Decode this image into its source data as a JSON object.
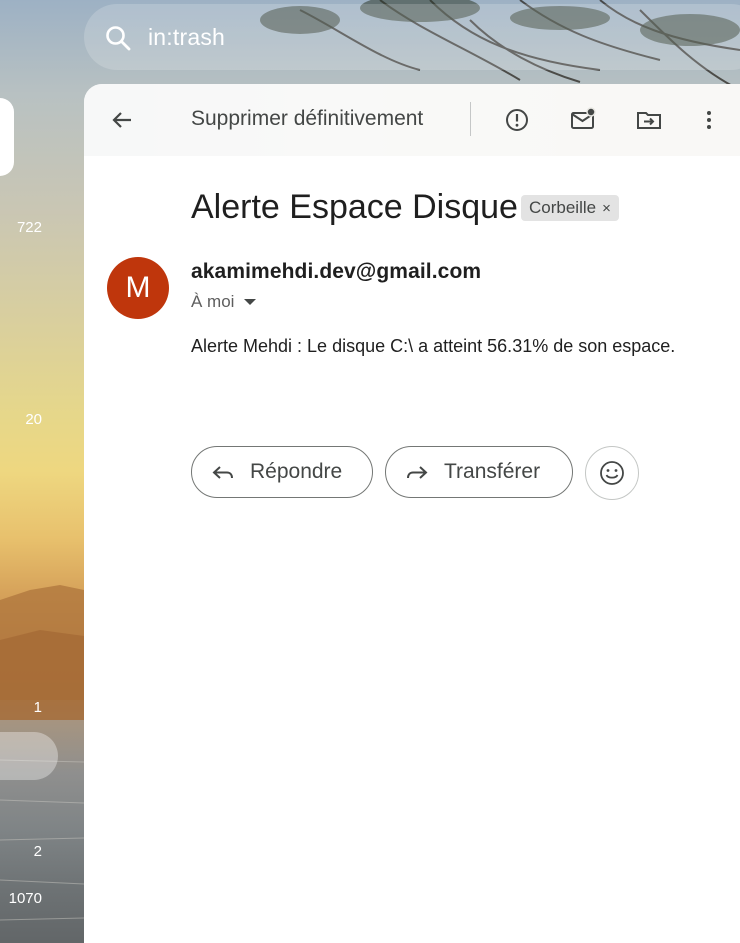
{
  "search": {
    "query": "in:trash",
    "icon": "search-icon"
  },
  "rail": {
    "counts": [
      "722",
      "20",
      "1",
      "2",
      "1070"
    ]
  },
  "toolbar": {
    "back_icon": "arrow-back-icon",
    "delete_forever_label": "Supprimer définitivement",
    "report_spam_icon": "report-spam-icon",
    "mark_unread_icon": "mark-unread-icon",
    "move_to_icon": "move-to-folder-icon",
    "more_icon": "more-vertical-icon"
  },
  "message": {
    "subject": "Alerte Espace Disque",
    "label": "Corbeille",
    "label_remove": "×",
    "avatar_letter": "M",
    "avatar_color": "#bf360c",
    "sender": "akamimehdi.dev@gmail.com",
    "recipient": "À moi",
    "body": "Alerte Mehdi : Le disque C:\\ a atteint 56.31% de son espace."
  },
  "actions": {
    "reply_label": "Répondre",
    "forward_label": "Transférer",
    "emoji_icon": "emoji-reaction-icon"
  }
}
